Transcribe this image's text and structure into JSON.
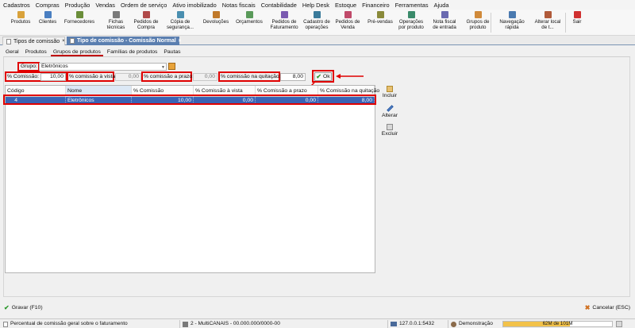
{
  "menu": [
    "Cadastros",
    "Compras",
    "Produção",
    "Vendas",
    "Ordem de serviço",
    "Ativo imobilizado",
    "Notas fiscais",
    "Contabilidade",
    "Help Desk",
    "Estoque",
    "Financeiro",
    "Ferramentas",
    "Ajuda"
  ],
  "toolbar": [
    {
      "label": "Produtos",
      "icon": "box-icon",
      "color": "#d9a23b"
    },
    {
      "label": "Clientes",
      "icon": "users-icon",
      "color": "#4a7fc1"
    },
    {
      "label": "Fornecedores",
      "icon": "supplier-icon",
      "color": "#6b8e3a"
    },
    {
      "label": "Fichas\ntécnicas",
      "icon": "sheet-icon",
      "color": "#7a7a7a"
    },
    {
      "label": "Pedidos de\nCompra",
      "icon": "cart-icon",
      "color": "#b04a4a"
    },
    {
      "label": "Cópia de\nsegurança...",
      "icon": "backup-icon",
      "color": "#4a8fb0"
    },
    {
      "label": "Devoluções",
      "icon": "return-icon",
      "color": "#c0792a"
    },
    {
      "label": "Orçamentos",
      "icon": "quote-icon",
      "color": "#5a9a5a"
    },
    {
      "label": "Pedidos de\nFaturamento",
      "icon": "billing-icon",
      "color": "#7a5ab0"
    },
    {
      "label": "Cadastro de\noperações",
      "icon": "operations-icon",
      "color": "#3a7a9a"
    },
    {
      "label": "Pedidos de\nVenda",
      "icon": "sale-icon",
      "color": "#c04a6a"
    },
    {
      "label": "Pré-vendas",
      "icon": "presale-icon",
      "color": "#8a8a3a"
    },
    {
      "label": "Operações\npor produto",
      "icon": "product-ops-icon",
      "color": "#3a8a6a"
    },
    {
      "label": "Nota fiscal\nde entrada",
      "icon": "invoice-icon",
      "color": "#6a6ab0"
    },
    {
      "label": "Grupos de\nproduto",
      "icon": "group-icon",
      "color": "#d08a3a"
    },
    {
      "label": "Navegação\nrápida",
      "icon": "navigation-icon",
      "color": "#4a7ab0"
    },
    {
      "label": "Alterar local\nde t...",
      "icon": "home-icon",
      "color": "#b05a3a"
    },
    {
      "label": "Sair",
      "icon": "power-icon",
      "color": "#d03030"
    }
  ],
  "doc_tabs": {
    "tab1": "Tipos de comissão",
    "tab2": "Tipo de comissão - Comissão Normal",
    "close": "×"
  },
  "sub_tabs": [
    "Geral",
    "Produtos",
    "Grupos de produtos",
    "Famílias de produtos",
    "Pautas"
  ],
  "form": {
    "grupo_label": "Grupo:",
    "grupo_value": "Eletrônicos",
    "comissao_label": "% Comissão:",
    "comissao_value": "10,00",
    "vista_label": "% comissão à vista:",
    "vista_value": "0,00",
    "prazo_label": "% comissão a prazo:",
    "prazo_value": "0,00",
    "quitacao_label": "% comissão na quitação:",
    "quitacao_value": "8,00",
    "ok_label": "Ok"
  },
  "grid": {
    "headers": [
      "Código",
      "Nome",
      "% Comissão",
      "% Comissão à vista",
      "% Comissão a prazo",
      "% Comissão na quitação"
    ],
    "rows": [
      [
        "4",
        "Eletrônicos",
        "10,00",
        "0,00",
        "0,00",
        "8,00"
      ]
    ]
  },
  "side_actions": [
    "Incluir",
    "Alterar",
    "Excluir"
  ],
  "footer": {
    "save": "Gravar (F10)",
    "cancel": "Cancelar (ESC)"
  },
  "status": {
    "hint": "Percentual de comissão geral sobre o faturamento",
    "company": "2 - MultiCANAIS - 00.000.000/0000-00",
    "server": "127.0.0.1:5432",
    "mode": "Demonstração",
    "memory": "62M de 101M",
    "memory_fraction": 0.61
  },
  "colors": {
    "accent": "#5b7fb0",
    "highlight": "#e00000",
    "selection": "#3a64b5"
  }
}
